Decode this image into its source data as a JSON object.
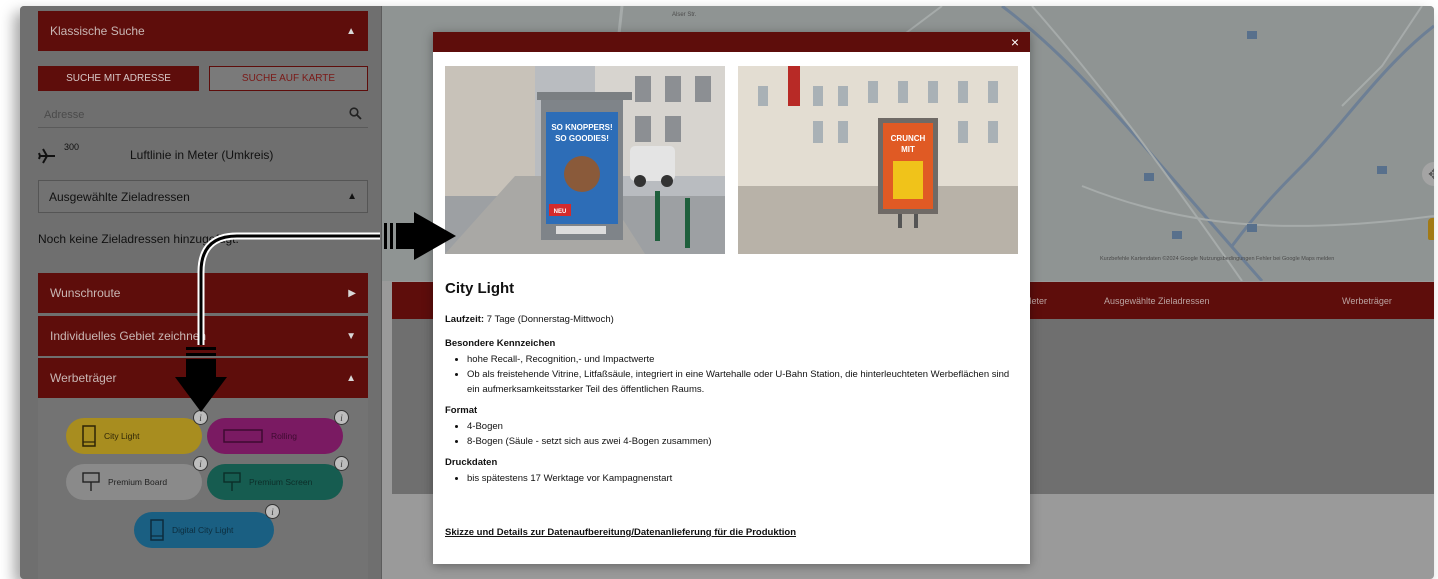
{
  "search": {
    "header": "Klassische Suche",
    "tab_address": "SUCHE MIT ADRESSE",
    "tab_map": "SUCHE AUF KARTE",
    "address_placeholder": "Adresse",
    "radius_value": "300",
    "radius_label": "Luftlinie in Meter (Umkreis)",
    "selected_header": "Ausgewählte Zieladressen",
    "no_targets": "Noch keine Zieladressen hinzugefügt."
  },
  "sections": {
    "route": "Wunschroute",
    "area": "Individuelles Gebiet zeichnen",
    "media": "Werbeträger"
  },
  "media_buttons": [
    {
      "label": "City Light",
      "color": "#c5a21a"
    },
    {
      "label": "Rolling",
      "color": "#8a1a6c"
    },
    {
      "label": "Premium Board",
      "color": "#7d7d7d"
    },
    {
      "label": "Premium Screen",
      "color": "#176b5c"
    },
    {
      "label": "Digital City Light",
      "color": "#1c6a91"
    }
  ],
  "map": {
    "street": "Alser Str.",
    "attribution": "Kurzbefehle  Kartendaten ©2024 Google  Nutzungsbedingungen  Fehler bei Google Maps melden"
  },
  "results_header": {
    "col_meter": "Meter",
    "col_targets": "Ausgewählte Zieladressen",
    "col_media": "Werbeträger"
  },
  "modal": {
    "title": "City Light",
    "runtime_label": "Laufzeit:",
    "runtime_value": " 7 Tage (Donnerstag-Mittwoch)",
    "features_heading": "Besondere Kennzeichen",
    "features": [
      "hohe Recall-, Recognition,- und Impactwerte",
      "Ob als freistehende Vitrine, Litfaßsäule, integriert in eine Wartehalle oder U-Bahn Station, die hinterleuchteten Werbeflächen sind ein aufmerksamkeitsstarker Teil des öffentlichen Raums."
    ],
    "format_heading": "Format",
    "formats": [
      "4-Bogen",
      "8-Bogen (Säule - setzt sich aus zwei 4-Bogen zusammen)"
    ],
    "print_heading": "Druckdaten",
    "print_items": [
      "bis spätestens 17 Werktage vor Kampagnenstart"
    ],
    "link": "Skizze und Details zur Datenaufbereitung/Datenanlieferung für die Produktion",
    "close": "×",
    "photo1_poster": "SO KNOPPERS! SO GOODIES!",
    "photo1_tag": "NEU",
    "photo2_poster": "CRUNCH MIT"
  },
  "colors": {
    "brand": "#7a100e",
    "overlay": "#7a7a7a"
  }
}
